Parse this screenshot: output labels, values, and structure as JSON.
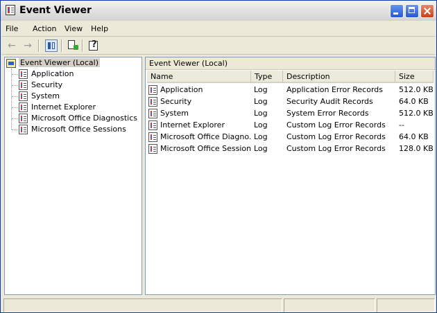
{
  "window": {
    "title": "Event Viewer"
  },
  "menu": [
    "File",
    "Action",
    "View",
    "Help"
  ],
  "tree": {
    "root": "Event Viewer (Local)",
    "items": [
      "Application",
      "Security",
      "System",
      "Internet Explorer",
      "Microsoft Office Diagnostics",
      "Microsoft Office Sessions"
    ]
  },
  "list": {
    "header": "Event Viewer (Local)",
    "columns": [
      "Name",
      "Type",
      "Description",
      "Size"
    ],
    "rows": [
      {
        "name": "Application",
        "type": "Log",
        "description": "Application Error Records",
        "size": "512.0 KB"
      },
      {
        "name": "Security",
        "type": "Log",
        "description": "Security Audit Records",
        "size": "64.0 KB"
      },
      {
        "name": "System",
        "type": "Log",
        "description": "System Error Records",
        "size": "512.0 KB"
      },
      {
        "name": "Internet Explorer",
        "type": "Log",
        "description": "Custom Log Error Records",
        "size": "--"
      },
      {
        "name": "Microsoft Office Diagno...",
        "type": "Log",
        "description": "Custom Log Error Records",
        "size": "64.0 KB"
      },
      {
        "name": "Microsoft Office Sessions",
        "type": "Log",
        "description": "Custom Log Error Records",
        "size": "128.0 KB"
      }
    ]
  },
  "toolbar_icons": [
    "back-arrow-icon",
    "forward-arrow-icon",
    "show-hide-tree-icon",
    "export-list-icon",
    "help-icon"
  ]
}
